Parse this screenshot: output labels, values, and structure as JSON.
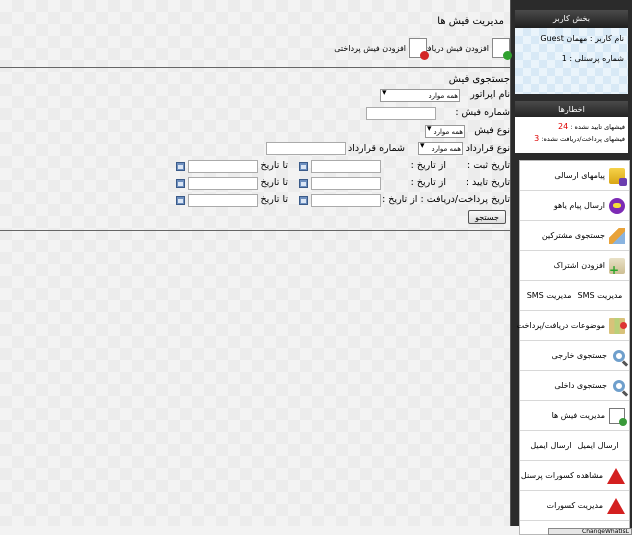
{
  "header": {
    "title": "مدیریت فیش ها",
    "shortcuts": [
      {
        "label": "افزودن فیش دریافتی"
      },
      {
        "label": "افزودن فیش پرداختی"
      }
    ]
  },
  "search": {
    "title": "جستجوی فیش",
    "operator_label": "نام اپراتور",
    "operator_value": "همه موارد",
    "receipt_no_label": "شماره فیش :",
    "receipt_type_label": "نوع فیش",
    "receipt_type_value": "همه موارد",
    "contract_type_label": "نوع قرارداد",
    "contract_type_value": "همه موارد",
    "contract_no_label": "شماره قرارداد :",
    "rows": [
      {
        "label": "تاریخ ثبت :",
        "from": "از تاریخ :",
        "to": "تا تاریخ :"
      },
      {
        "label": "تاریخ تایید :",
        "from": "از تاریخ :",
        "to": "تا تاریخ :"
      },
      {
        "label": "تاریخ پرداخت/دریافت : از تاریخ :",
        "from": "",
        "to": "تا تاریخ :"
      }
    ],
    "button_label": "جستجو"
  },
  "sidebar": {
    "user_section_title": "بخش کاربر",
    "username_label": "نام کاربر : مهمان",
    "username_value": "Guest",
    "personnel_label": "شماره پرسنلی : 1",
    "alerts_title": "اخطارها",
    "alert_unconfirmed_label": "فیشهای تایید نشده :",
    "alert_unconfirmed_count": "24",
    "alert_unpaid_label": "فیشهای پرداخت/دریافت نشده:",
    "alert_unpaid_count": "3",
    "menu": [
      {
        "label": "پیامهای ارسالی",
        "icon": "folder-message-icon"
      },
      {
        "label": "ارسال پیام یاهو",
        "icon": "yahoo-messenger-icon"
      },
      {
        "label": "جستجوی مشترکین",
        "icon": "pencil-search-icon"
      },
      {
        "label": "افزودن اشتراک",
        "icon": "add-subscription-icon"
      },
      {
        "label": "مدیریت SMS",
        "label2": "مدیریت SMS",
        "icon": ""
      },
      {
        "label": "موضوعات دریافت/پرداخت",
        "icon": "map-topics-icon"
      },
      {
        "label": "جستجوی خارجی",
        "icon": "magnifier-icon"
      },
      {
        "label": "جستجوی داخلی",
        "icon": "magnifier-icon"
      },
      {
        "label": "مدیریت فیش ها",
        "icon": "receipt-doc-icon"
      },
      {
        "label": "ارسال ایمیل",
        "label2": "ارسال ایمیل",
        "icon": ""
      },
      {
        "label": "مشاهده کسورات پرسنل",
        "icon": "warning-icon"
      },
      {
        "label": "مدیریت کسورات",
        "icon": "warning-icon"
      }
    ]
  },
  "statusbar": {
    "text": "ChangeWhatIsL"
  }
}
